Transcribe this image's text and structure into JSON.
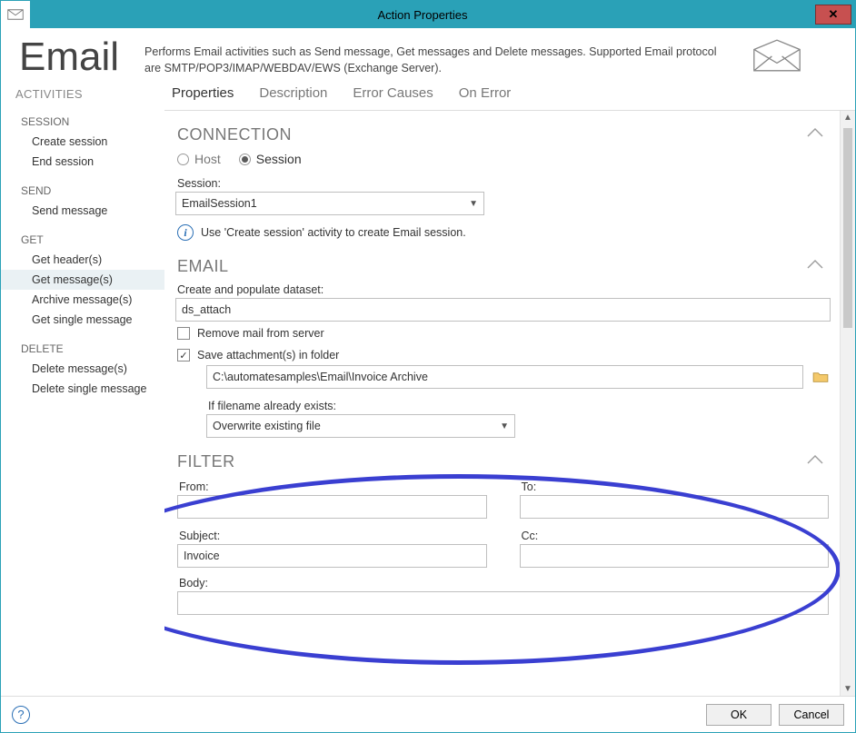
{
  "window": {
    "title": "Action Properties",
    "close_glyph": "✕"
  },
  "header": {
    "title": "Email",
    "description": "Performs Email activities such as Send message, Get messages and Delete messages. Supported Email protocol are SMTP/POP3/IMAP/WEBDAV/EWS (Exchange Server)."
  },
  "sidebar": {
    "title": "ACTIVITIES",
    "groups": [
      {
        "label": "SESSION",
        "items": [
          "Create session",
          "End session"
        ]
      },
      {
        "label": "SEND",
        "items": [
          "Send message"
        ]
      },
      {
        "label": "GET",
        "items": [
          "Get header(s)",
          "Get message(s)",
          "Archive message(s)",
          "Get single message"
        ]
      },
      {
        "label": "DELETE",
        "items": [
          "Delete message(s)",
          "Delete single message"
        ]
      }
    ],
    "active": "Get message(s)"
  },
  "tabs": {
    "items": [
      "Properties",
      "Description",
      "Error Causes",
      "On Error"
    ],
    "active": "Properties"
  },
  "form": {
    "connection": {
      "heading": "CONNECTION",
      "mode_options": [
        "Host",
        "Session"
      ],
      "mode_selected": "Session",
      "session_label": "Session:",
      "session_value": "EmailSession1",
      "hint": "Use 'Create session' activity to create Email session."
    },
    "email": {
      "heading": "EMAIL",
      "dataset_label": "Create and populate dataset:",
      "dataset_value": "ds_attach",
      "remove_label": "Remove mail from server",
      "remove_checked": false,
      "save_attach_label": "Save attachment(s) in folder",
      "save_attach_checked": true,
      "folder_value": "C:\\automatesamples\\Email\\Invoice Archive",
      "exists_label": "If filename already exists:",
      "exists_value": "Overwrite existing file"
    },
    "filter": {
      "heading": "FILTER",
      "from_label": "From:",
      "from_value": "",
      "to_label": "To:",
      "to_value": "",
      "subject_label": "Subject:",
      "subject_value": "Invoice",
      "cc_label": "Cc:",
      "cc_value": "",
      "body_label": "Body:",
      "body_value": ""
    }
  },
  "footer": {
    "ok": "OK",
    "cancel": "Cancel"
  }
}
